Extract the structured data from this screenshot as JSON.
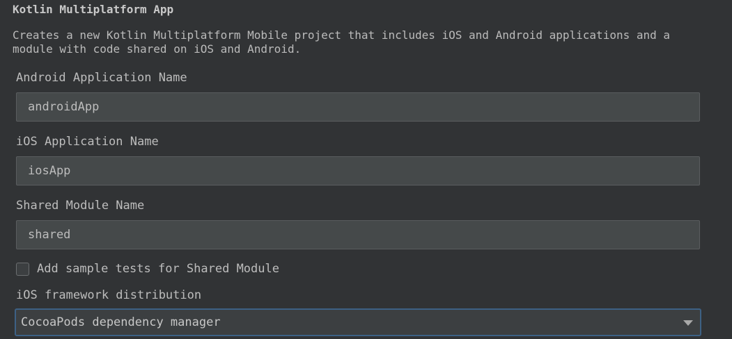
{
  "header": {
    "title": "Kotlin Multiplatform App",
    "description": "Creates a new Kotlin Multiplatform Mobile project that includes iOS and Android applications and a module with code shared on iOS and Android."
  },
  "fields": {
    "android_app_name": {
      "label": "Android Application Name",
      "value": "androidApp"
    },
    "ios_app_name": {
      "label": "iOS Application Name",
      "value": "iosApp"
    },
    "shared_module_name": {
      "label": "Shared Module Name",
      "value": "shared"
    }
  },
  "sample_tests": {
    "label": "Add sample tests for Shared Module",
    "checked": false
  },
  "ios_distribution": {
    "label": "iOS framework distribution",
    "selected": "CocoaPods dependency manager",
    "icon": "chevron-down-icon"
  },
  "colors": {
    "background": "#313335",
    "field_background": "#45494a",
    "focus_border": "#3d6185"
  }
}
